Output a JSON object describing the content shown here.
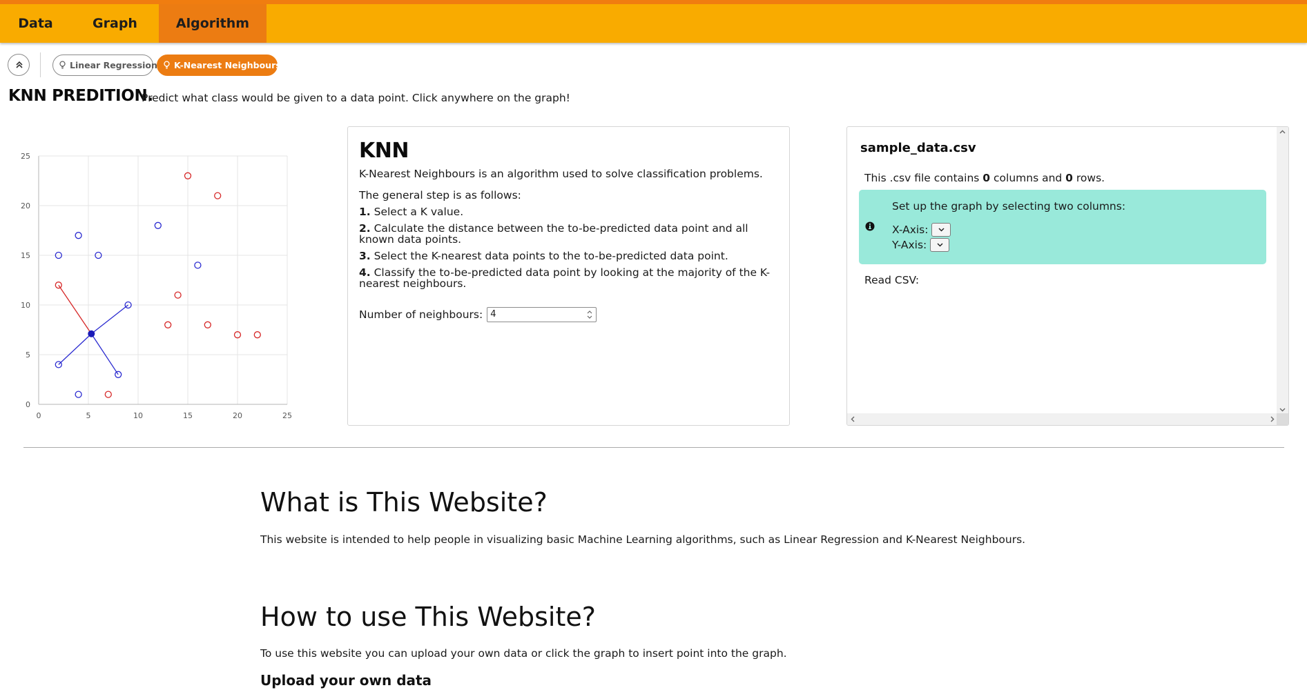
{
  "nav": {
    "tabs": [
      {
        "label": "Data"
      },
      {
        "label": "Graph"
      },
      {
        "label": "Algorithm"
      }
    ],
    "active_index": 2,
    "colors": {
      "bar": "#f9ab00",
      "active": "#ec7c12",
      "top_border": "#f07d10"
    }
  },
  "subnav": {
    "collapse_icon": "chevrons-up-icon",
    "pills": [
      {
        "label": "Linear Regression",
        "icon": "lightbulb-icon",
        "active": false
      },
      {
        "label": "K-Nearest Neighbours",
        "icon": "lightbulb-icon",
        "active": true
      }
    ]
  },
  "prediction": {
    "title": "KNN PREDITION.",
    "description": "Predict what class would be given to a data point. Click anywhere on the graph!"
  },
  "chart_data": {
    "type": "scatter",
    "title": "",
    "xlabel": "",
    "ylabel": "",
    "xlim": [
      0,
      25
    ],
    "ylim": [
      0,
      25
    ],
    "x_ticks": [
      "0",
      "5",
      "10",
      "15",
      "20",
      "25"
    ],
    "y_ticks": [
      "0",
      "5",
      "10",
      "15",
      "20",
      "25"
    ],
    "grid": true,
    "legend": "none",
    "series": [
      {
        "color": "#d62828",
        "points": [
          [
            15,
            23
          ],
          [
            18,
            21
          ],
          [
            2,
            12
          ],
          [
            14,
            11
          ],
          [
            13,
            8
          ],
          [
            17,
            8
          ],
          [
            20,
            7
          ],
          [
            22,
            7
          ],
          [
            7,
            1
          ]
        ]
      },
      {
        "color": "#2a2ad0",
        "points": [
          [
            4,
            17
          ],
          [
            12,
            18
          ],
          [
            2,
            15
          ],
          [
            6,
            15
          ],
          [
            16,
            14
          ],
          [
            9,
            10
          ],
          [
            2,
            4
          ],
          [
            8,
            3
          ],
          [
            4,
            1
          ]
        ]
      }
    ],
    "query_point": {
      "x": 5.3,
      "y": 7.1,
      "color": "#1a1ab8"
    },
    "neighbour_links": [
      {
        "to": [
          2,
          12
        ],
        "color": "#d62828"
      },
      {
        "to": [
          9,
          10
        ],
        "color": "#2a2ad0"
      },
      {
        "to": [
          2,
          4
        ],
        "color": "#2a2ad0"
      },
      {
        "to": [
          8,
          3
        ],
        "color": "#2a2ad0"
      }
    ]
  },
  "knn": {
    "title": "KNN",
    "intro": "K-Nearest Neighbours is an algorithm used to solve classification problems.",
    "steps_heading": "The general step is as follows:",
    "steps": [
      {
        "num": "1.",
        "text": " Select a K value."
      },
      {
        "num": "2.",
        "text": " Calculate the distance between the to-be-predicted data point and all known data points."
      },
      {
        "num": "3.",
        "text": " Select the K-nearest data points to the to-be-predicted data point."
      },
      {
        "num": "4.",
        "text": " Classify the to-be-predicted data point by looking at the majority of the K-nearest neighbours."
      }
    ],
    "neighbours_label": "Number of neighbours:",
    "neighbours_value": "4"
  },
  "csv": {
    "filename": "sample_data.csv",
    "info_prefix": "This .csv file contains ",
    "columns": "0",
    "info_mid": " columns and ",
    "rows": "0",
    "info_suffix": " rows.",
    "setup_text": "Set up the graph by selecting two columns:",
    "x_axis_label": "X-Axis:",
    "y_axis_label": "Y-Axis:",
    "read_label": "Read CSV:",
    "setup_color": "#99e9da"
  },
  "about": {
    "what_heading": "What is This Website?",
    "what_text": "This website is intended to help people in visualizing basic Machine Learning algorithms, such as Linear Regression and K-Nearest Neighbours.",
    "how_heading": "How to use This Website?",
    "how_text": "To use this website you can upload your own data or click the graph to insert point into the graph.",
    "upload_heading": "Upload your own data"
  }
}
